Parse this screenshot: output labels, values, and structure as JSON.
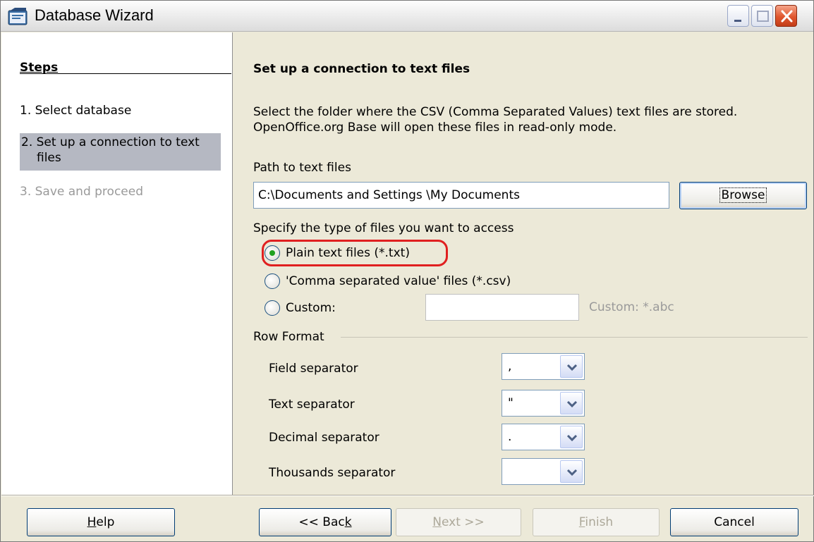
{
  "window": {
    "title": "Database Wizard"
  },
  "sidebar": {
    "heading": "Steps",
    "steps": [
      {
        "label": "1. Select database"
      },
      {
        "label_line1": "2. Set up a connection to text",
        "label_line2": "files"
      },
      {
        "label": "3. Save and proceed"
      }
    ]
  },
  "main": {
    "title": "Set up a connection to text files",
    "description_line1": "Select the folder where the CSV (Comma Separated Values) text files are stored.",
    "description_line2": "OpenOffice.org Base will open these files in read-only mode.",
    "path_label": "Path to text files",
    "path_value": "C:\\Documents and Settings \\My Documents",
    "browse_label": "Browse",
    "file_type_label": "Specify the type of files you want to access",
    "file_types": [
      {
        "label": "Plain text files (*.txt)",
        "checked": true
      },
      {
        "label": "'Comma separated value' files (*.csv)",
        "checked": false
      },
      {
        "label": "Custom:",
        "checked": false
      }
    ],
    "custom_value": "",
    "custom_hint": "Custom: *.abc",
    "row_format_label": "Row Format",
    "separators": [
      {
        "label": "Field separator",
        "value": ","
      },
      {
        "label": "Text separator",
        "value": "\""
      },
      {
        "label": "Decimal separator",
        "value": "."
      },
      {
        "label": "Thousands separator",
        "value": ""
      }
    ]
  },
  "buttons": {
    "help": {
      "pre": "",
      "key": "H",
      "post": "elp"
    },
    "back": {
      "pre": "<< Bac",
      "key": "k",
      "post": ""
    },
    "next": {
      "pre": "",
      "key": "N",
      "post": "ext >>"
    },
    "finish": {
      "pre": "",
      "key": "F",
      "post": "inish"
    },
    "cancel": "Cancel"
  },
  "colors": {
    "highlight": "#e02020",
    "selected_step_bg": "#b5b8c2",
    "radio_dot": "#21a121"
  }
}
